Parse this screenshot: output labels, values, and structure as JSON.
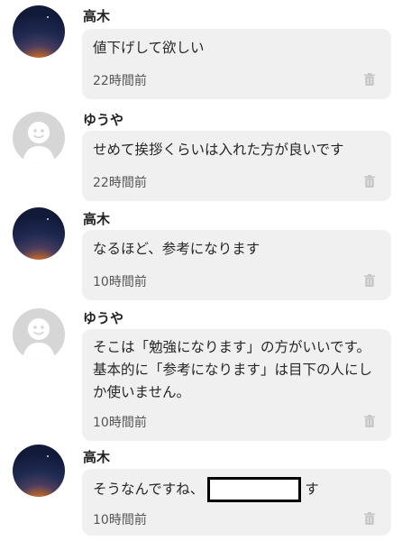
{
  "comments": [
    {
      "author": "高木",
      "avatar": "night-sky-avatar",
      "text": "値下げして欲しい",
      "time": "22時間前"
    },
    {
      "author": "ゆうや",
      "avatar": "default-avatar",
      "text": "せめて挨拶くらいは入れた方が良いです",
      "time": "22時間前"
    },
    {
      "author": "高木",
      "avatar": "night-sky-avatar",
      "text": "なるほど、参考になります",
      "time": "10時間前"
    },
    {
      "author": "ゆうや",
      "avatar": "default-avatar",
      "text": "そこは「勉強になります」の方がいいです。基本的に「参考になります」は目下の人にしか使いません。",
      "time": "10時間前"
    },
    {
      "author": "高木",
      "avatar": "night-sky-avatar",
      "text_before": "そうなんですね、",
      "text_after": "す",
      "time": "10時間前"
    }
  ],
  "icons": {
    "delete": "trash-icon"
  }
}
